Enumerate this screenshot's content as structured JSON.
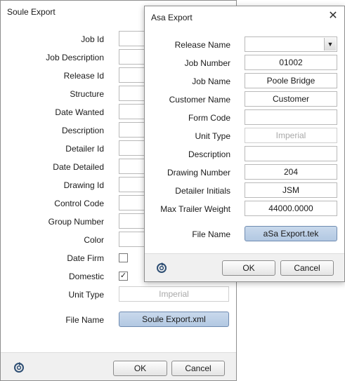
{
  "soule": {
    "title": "Soule Export",
    "labels": {
      "job_id": "Job Id",
      "job_description": "Job Description",
      "release_id": "Release Id",
      "structure": "Structure",
      "date_wanted": "Date Wanted",
      "description": "Description",
      "detailer_id": "Detailer Id",
      "date_detailed": "Date Detailed",
      "drawing_id": "Drawing Id",
      "control_code": "Control Code",
      "group_number": "Group Number",
      "color": "Color",
      "date_firm": "Date Firm",
      "domestic": "Domestic",
      "unit_type": "Unit Type",
      "file_name": "File Name"
    },
    "values": {
      "unit_type": "Imperial",
      "file_name": "Soule Export.xml"
    },
    "checkboxes": {
      "date_firm": false,
      "domestic": true
    },
    "buttons": {
      "ok": "OK",
      "cancel": "Cancel"
    }
  },
  "asa": {
    "title": "Asa Export",
    "labels": {
      "release_name": "Release Name",
      "job_number": "Job Number",
      "job_name": "Job Name",
      "customer_name": "Customer Name",
      "form_code": "Form Code",
      "unit_type": "Unit Type",
      "description": "Description",
      "drawing_number": "Drawing Number",
      "detailer_initials": "Detailer Initials",
      "max_trailer_weight": "Max Trailer Weight",
      "file_name": "File Name"
    },
    "values": {
      "release_name": "",
      "job_number": "01002",
      "job_name": "Poole Bridge",
      "customer_name": "Customer",
      "form_code": "",
      "unit_type": "Imperial",
      "description": "",
      "drawing_number": "204",
      "detailer_initials": "JSM",
      "max_trailer_weight": "44000.0000",
      "file_name": "aSa Export.tek"
    },
    "close_glyph": "✕",
    "buttons": {
      "ok": "OK",
      "cancel": "Cancel"
    }
  },
  "icons": {
    "refresh": "refresh-icon",
    "check": "✓",
    "dropdown": "▼"
  }
}
